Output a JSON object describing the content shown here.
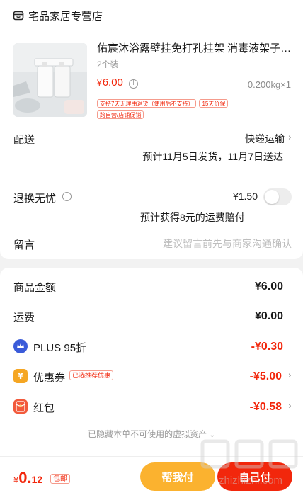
{
  "shop": {
    "name": "宅品家居专营店",
    "icon": "store-icon"
  },
  "product": {
    "title": "佑宸沐浴露壁挂免打孔挂架 消毒液架子 ...",
    "spec": "2个装",
    "price_symbol": "¥",
    "price": "6.00",
    "weight_qty": "0.200kg×1",
    "tags": [
      "支持7天无理由退货（使用后不支持）",
      "15天价保",
      "跨自营/店铺促销"
    ]
  },
  "delivery": {
    "label": "配送",
    "method": "快递运输",
    "estimate": "预计11月5日发货，11月7日送达"
  },
  "return_insurance": {
    "label": "退换无忧",
    "price": "¥1.50",
    "note": "预计获得8元的运费赔付",
    "enabled": false
  },
  "remark": {
    "label": "留言",
    "placeholder": "建议留言前先与商家沟通确认"
  },
  "summary": {
    "goods_label": "商品金额",
    "goods_value": "¥6.00",
    "freight_label": "运费",
    "freight_value": "¥0.00",
    "plus_label": "PLUS 95折",
    "plus_value": "-¥0.30",
    "coupon_label": "优惠券",
    "coupon_badge": "已选推荐优惠",
    "coupon_value": "-¥5.00",
    "redpacket_label": "红包",
    "redpacket_value": "-¥0.58",
    "hidden_note": "已隐藏本单不可使用的虚拟资产"
  },
  "bottom": {
    "total_symbol": "¥",
    "total_int": "0.",
    "total_dec": "12",
    "free_shipping": "包邮",
    "friend_pay": "帮我付",
    "self_pay": "自己付"
  },
  "watermark_text": "zhizhizhi.com",
  "colors": {
    "accent_red": "#f2270c",
    "friend_pay_yellow": "#fbb22f",
    "background": "#f2f2f2"
  }
}
